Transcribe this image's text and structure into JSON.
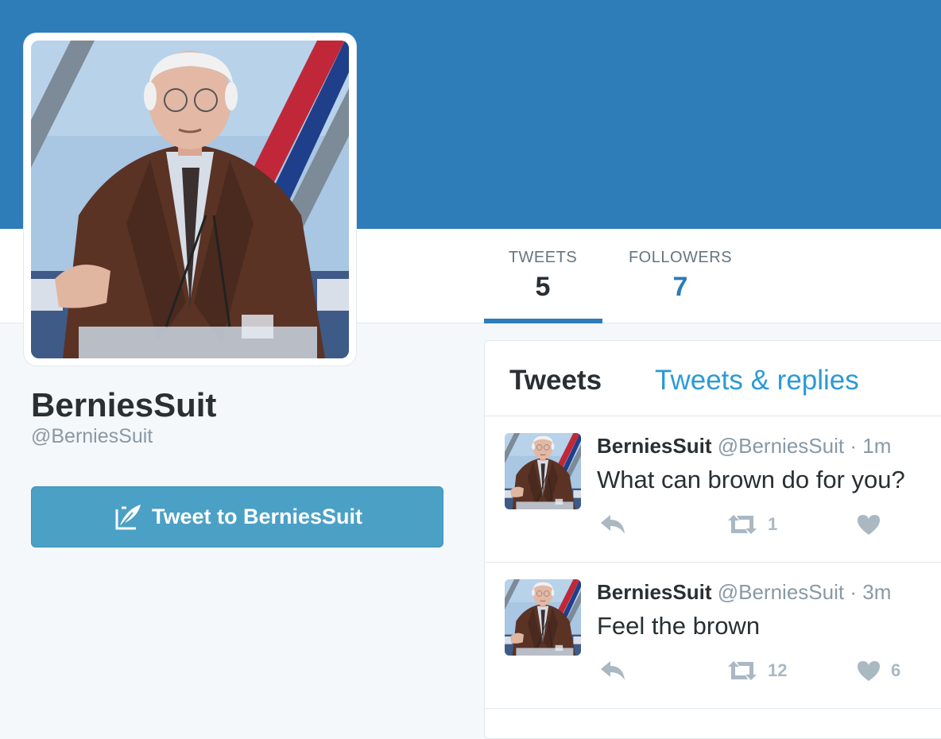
{
  "profile": {
    "display_name": "BerniesSuit",
    "handle": "@BerniesSuit"
  },
  "stats": {
    "tweets_label": "TWEETS",
    "tweets_count": "5",
    "followers_label": "FOLLOWERS",
    "followers_count": "7"
  },
  "tweet_to_button": {
    "label": "Tweet to BerniesSuit",
    "icon": "quill-icon"
  },
  "timeline_tabs": {
    "tweets": "Tweets",
    "replies": "Tweets & replies"
  },
  "tweets": [
    {
      "name": "BerniesSuit",
      "handle": "@BerniesSuit",
      "separator": "·",
      "time": "1m",
      "text": "What can brown do for you?",
      "retweets": "1",
      "likes": ""
    },
    {
      "name": "BerniesSuit",
      "handle": "@BerniesSuit",
      "separator": "·",
      "time": "3m",
      "text": "Feel the brown",
      "retweets": "12",
      "likes": "6"
    }
  ],
  "colors": {
    "banner": "#2e7cb8",
    "accent": "#2b7bb9",
    "button": "#4ba0c5",
    "muted": "#8899a6",
    "action_icon": "#aab8c2"
  }
}
